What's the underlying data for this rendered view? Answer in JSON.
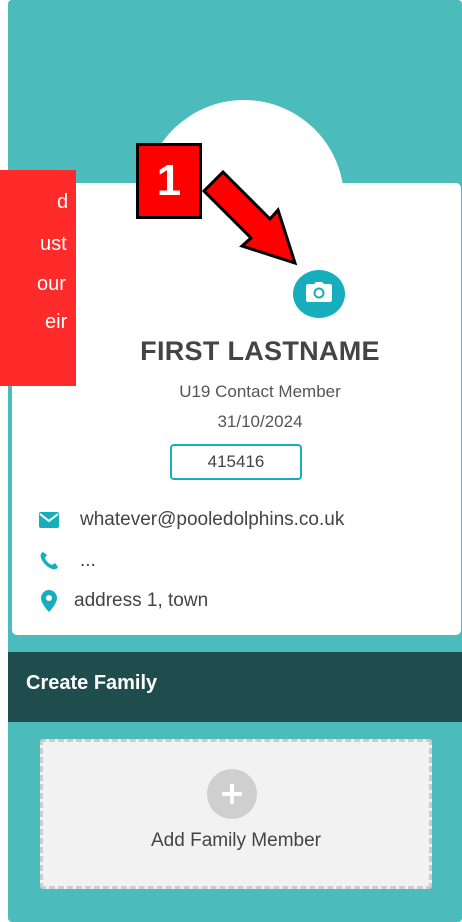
{
  "profile": {
    "name": "FIRST LASTNAME",
    "member_type": "U19 Contact Member",
    "date": "31/10/2024",
    "member_id": "415416"
  },
  "contact": {
    "email": "whatever@pooledolphins.co.uk",
    "phone": "...",
    "address": "address 1, town"
  },
  "family": {
    "section_title": "Create Family",
    "add_label": "Add Family Member"
  },
  "annotation": {
    "marker_label": "1",
    "note_lines": [
      "d",
      "ust",
      "our",
      "eir"
    ]
  },
  "icons": {
    "camera": "camera-icon",
    "email": "envelope-icon",
    "phone": "phone-icon",
    "address": "map-marker-icon",
    "add": "plus-icon"
  },
  "colors": {
    "panel": "#4bbcbb",
    "accent": "#16aebd",
    "family_bar": "#1f4d4d",
    "annotation": "#ff0000"
  }
}
